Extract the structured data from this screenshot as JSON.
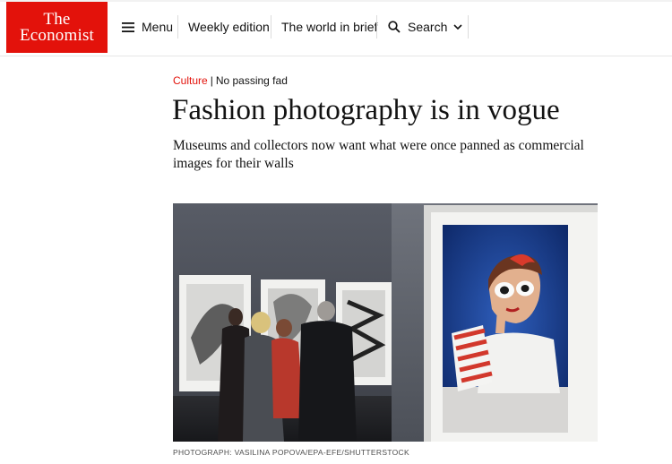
{
  "logo": {
    "line1": "The",
    "line2": "Economist"
  },
  "nav": {
    "menu_label": "Menu",
    "weekly_label": "Weekly edition",
    "brief_label": "The world in brief",
    "search_label": "Search"
  },
  "icons": {
    "menu": "menu-icon",
    "search": "search-icon",
    "chevron": "chevron-down-icon"
  },
  "colors": {
    "brand_red": "#e3120b",
    "text": "#121212"
  },
  "article": {
    "section": "Culture",
    "separator": "|",
    "fly_title": "No passing fad",
    "headline": "Fashion photography is in vogue",
    "standfirst": "Museums and collectors now want what were once panned as commercial images for their walls",
    "photo_credit": "PHOTOGRAPH: VASILINA POPOVA/EPA-EFE/SHUTTERSTOCK"
  }
}
